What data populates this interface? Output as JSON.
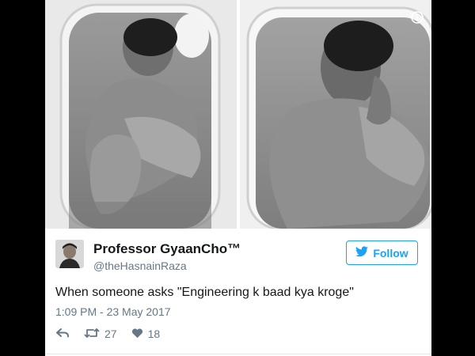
{
  "tweet": {
    "author_name": "Professor GyaanCho™",
    "author_handle": "@theHasnainRaza",
    "follow_label": "Follow",
    "text": "When someone asks \"Engineering k baad kya kroge\"",
    "timestamp": "1:09 PM - 23 May 2017",
    "retweets": "27",
    "likes": "18"
  },
  "icons": {
    "info": "info-icon",
    "follow": "twitter-bird-icon",
    "reply": "reply-icon",
    "retweet": "retweet-icon",
    "like": "heart-icon"
  },
  "colors": {
    "accent": "#1da1f2",
    "text": "#14171a",
    "muted": "#657786"
  }
}
